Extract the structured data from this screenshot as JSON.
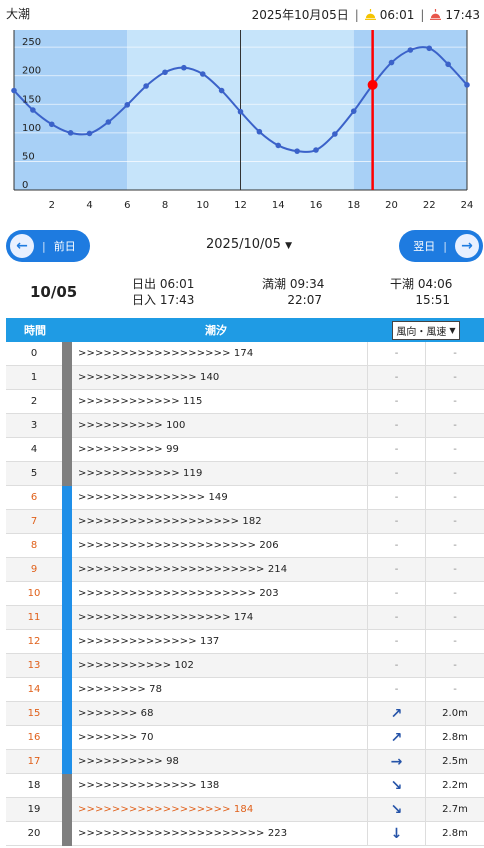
{
  "header": {
    "place": "大潮",
    "date": "2025年10月05日",
    "sunrise": "06:01",
    "sunset": "17:43"
  },
  "chart_data": {
    "type": "line",
    "x": [
      0,
      1,
      2,
      3,
      4,
      5,
      6,
      7,
      8,
      9,
      10,
      11,
      12,
      13,
      14,
      15,
      16,
      17,
      18,
      19,
      20,
      21,
      22,
      23,
      24
    ],
    "values": [
      174,
      140,
      115,
      100,
      99,
      119,
      149,
      182,
      206,
      214,
      203,
      174,
      137,
      102,
      78,
      68,
      70,
      98,
      138,
      184,
      223,
      245,
      248,
      220,
      184
    ],
    "xticks": [
      "2",
      "4",
      "6",
      "8",
      "10",
      "12",
      "14",
      "16",
      "18",
      "20",
      "22",
      "24"
    ],
    "yticks": [
      "0",
      "50",
      "100",
      "150",
      "200",
      "250"
    ],
    "ylim": [
      0,
      280
    ],
    "current_hour": 19,
    "daylight": [
      6,
      18
    ],
    "colors": {
      "night": "#a8d0f6",
      "day": "#c6e4fa",
      "line": "#3b62c9",
      "marker": "#ff0000"
    }
  },
  "nav": {
    "prev": "前日",
    "next": "翌日",
    "date": "2025/10/05"
  },
  "summary": {
    "date": "10/05",
    "sunrise_label": "日出 06:01",
    "sunset_label": "日入 17:43",
    "high_label": "満潮 09:34",
    "high2": "22:07",
    "low_label": "干潮 04:06",
    "low2": "15:51"
  },
  "table": {
    "headers": {
      "time": "時間",
      "tide": "潮汐",
      "wind": "風向・風速"
    },
    "rows": [
      {
        "hour": "0",
        "bar": ">>>>>>>>>>>>>>>>>> 174",
        "dir": "-",
        "speed": "-",
        "day": false
      },
      {
        "hour": "1",
        "bar": ">>>>>>>>>>>>>> 140",
        "dir": "-",
        "speed": "-",
        "day": false
      },
      {
        "hour": "2",
        "bar": ">>>>>>>>>>>> 115",
        "dir": "-",
        "speed": "-",
        "day": false
      },
      {
        "hour": "3",
        "bar": ">>>>>>>>>> 100",
        "dir": "-",
        "speed": "-",
        "day": false
      },
      {
        "hour": "4",
        "bar": ">>>>>>>>>> 99",
        "dir": "-",
        "speed": "-",
        "day": false
      },
      {
        "hour": "5",
        "bar": ">>>>>>>>>>>> 119",
        "dir": "-",
        "speed": "-",
        "day": false
      },
      {
        "hour": "6",
        "bar": ">>>>>>>>>>>>>>> 149",
        "dir": "-",
        "speed": "-",
        "day": true
      },
      {
        "hour": "7",
        "bar": ">>>>>>>>>>>>>>>>>>> 182",
        "dir": "-",
        "speed": "-",
        "day": true
      },
      {
        "hour": "8",
        "bar": ">>>>>>>>>>>>>>>>>>>>> 206",
        "dir": "-",
        "speed": "-",
        "day": true
      },
      {
        "hour": "9",
        "bar": ">>>>>>>>>>>>>>>>>>>>>> 214",
        "dir": "-",
        "speed": "-",
        "day": true
      },
      {
        "hour": "10",
        "bar": ">>>>>>>>>>>>>>>>>>>>> 203",
        "dir": "-",
        "speed": "-",
        "day": true
      },
      {
        "hour": "11",
        "bar": ">>>>>>>>>>>>>>>>>> 174",
        "dir": "-",
        "speed": "-",
        "day": true
      },
      {
        "hour": "12",
        "bar": ">>>>>>>>>>>>>> 137",
        "dir": "-",
        "speed": "-",
        "day": true
      },
      {
        "hour": "13",
        "bar": ">>>>>>>>>>> 102",
        "dir": "-",
        "speed": "-",
        "day": true
      },
      {
        "hour": "14",
        "bar": ">>>>>>>> 78",
        "dir": "-",
        "speed": "-",
        "day": true
      },
      {
        "hour": "15",
        "bar": ">>>>>>> 68",
        "dir": "↗",
        "speed": "2.0m",
        "day": true
      },
      {
        "hour": "16",
        "bar": ">>>>>>> 70",
        "dir": "↗",
        "speed": "2.8m",
        "day": true
      },
      {
        "hour": "17",
        "bar": ">>>>>>>>>> 98",
        "dir": "→",
        "speed": "2.5m",
        "day": true
      },
      {
        "hour": "18",
        "bar": ">>>>>>>>>>>>>> 138",
        "dir": "↘",
        "speed": "2.2m",
        "day": false
      },
      {
        "hour": "19",
        "bar": ">>>>>>>>>>>>>>>>>> 184",
        "dir": "↘",
        "speed": "2.7m",
        "day": false,
        "current": true
      },
      {
        "hour": "20",
        "bar": ">>>>>>>>>>>>>>>>>>>>>> 223",
        "dir": "↓",
        "speed": "2.8m",
        "day": false
      }
    ]
  }
}
